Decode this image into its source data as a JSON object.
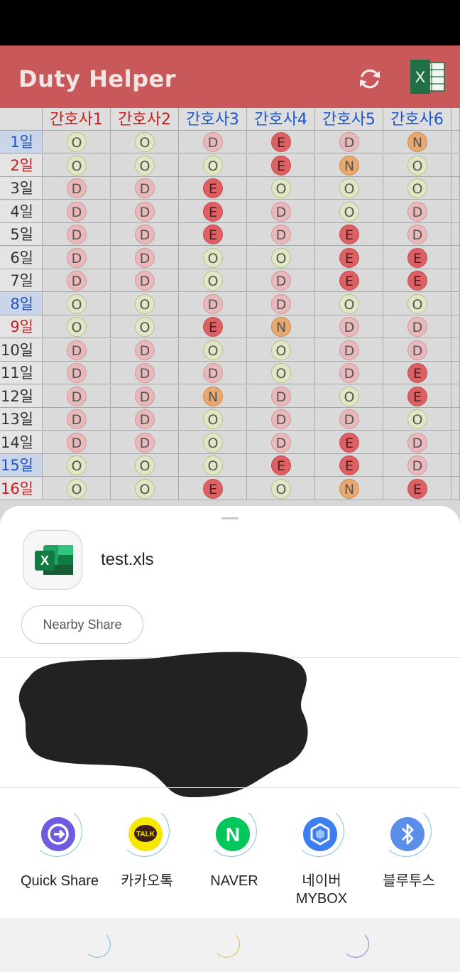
{
  "app": {
    "title": "Duty Helper",
    "icons": {
      "refresh": "refresh-icon",
      "excel": "excel-export-icon"
    }
  },
  "colors": {
    "appbar": "#c8585a",
    "header_red": "#cf1b1b",
    "header_blue": "#1d55c8",
    "off": "#dfe7c4",
    "day": "#e8b8bb",
    "evening": "#df6063",
    "night": "#e8a86e"
  },
  "table": {
    "headers": [
      {
        "label": "간호사1",
        "color": "red"
      },
      {
        "label": "간호사2",
        "color": "red"
      },
      {
        "label": "간호사3",
        "color": "blue"
      },
      {
        "label": "간호사4",
        "color": "blue"
      },
      {
        "label": "간호사5",
        "color": "blue"
      },
      {
        "label": "간호사6",
        "color": "blue"
      }
    ],
    "rows": [
      {
        "day": "1일",
        "style": "blue",
        "shifts": [
          "O",
          "O",
          "D",
          "E",
          "D",
          "N"
        ]
      },
      {
        "day": "2일",
        "style": "red",
        "shifts": [
          "O",
          "O",
          "O",
          "E",
          "N",
          "O"
        ]
      },
      {
        "day": "3일",
        "style": "normal",
        "shifts": [
          "D",
          "D",
          "E",
          "O",
          "O",
          "O"
        ]
      },
      {
        "day": "4일",
        "style": "normal",
        "shifts": [
          "D",
          "D",
          "E",
          "D",
          "O",
          "D"
        ]
      },
      {
        "day": "5일",
        "style": "normal",
        "shifts": [
          "D",
          "D",
          "E",
          "D",
          "E",
          "D"
        ]
      },
      {
        "day": "6일",
        "style": "normal",
        "shifts": [
          "D",
          "D",
          "O",
          "O",
          "E",
          "E"
        ]
      },
      {
        "day": "7일",
        "style": "normal",
        "shifts": [
          "D",
          "D",
          "O",
          "D",
          "E",
          "E"
        ]
      },
      {
        "day": "8일",
        "style": "blue",
        "shifts": [
          "O",
          "O",
          "D",
          "D",
          "O",
          "O"
        ]
      },
      {
        "day": "9일",
        "style": "red",
        "shifts": [
          "O",
          "O",
          "E",
          "N",
          "D",
          "D"
        ]
      },
      {
        "day": "10일",
        "style": "normal",
        "shifts": [
          "D",
          "D",
          "O",
          "O",
          "D",
          "D"
        ]
      },
      {
        "day": "11일",
        "style": "normal",
        "shifts": [
          "D",
          "D",
          "D",
          "O",
          "D",
          "E"
        ]
      },
      {
        "day": "12일",
        "style": "normal",
        "shifts": [
          "D",
          "D",
          "N",
          "D",
          "O",
          "E"
        ]
      },
      {
        "day": "13일",
        "style": "normal",
        "shifts": [
          "D",
          "D",
          "O",
          "D",
          "D",
          "O"
        ]
      },
      {
        "day": "14일",
        "style": "normal",
        "shifts": [
          "D",
          "D",
          "O",
          "D",
          "E",
          "D"
        ]
      },
      {
        "day": "15일",
        "style": "blue",
        "shifts": [
          "O",
          "O",
          "O",
          "E",
          "E",
          "D"
        ]
      },
      {
        "day": "16일",
        "style": "red",
        "shifts": [
          "O",
          "O",
          "E",
          "O",
          "N",
          "E"
        ]
      }
    ]
  },
  "share": {
    "file_name": "test.xls",
    "file_icon": "excel-file-icon",
    "nearby_label": "Nearby Share",
    "apps": [
      {
        "label": "Quick Share",
        "icon": "quick-share-icon"
      },
      {
        "label": "카카오톡",
        "icon": "kakaotalk-icon",
        "icon_text": "TALK"
      },
      {
        "label": "NAVER",
        "icon": "naver-icon",
        "icon_text": "N"
      },
      {
        "label": "네이버\nMYBOX",
        "icon": "naver-mybox-icon"
      },
      {
        "label": "블루투스",
        "icon": "bluetooth-icon"
      }
    ]
  },
  "navbar": {
    "icons": [
      "recent-apps-moon-icon",
      "home-moon-icon",
      "back-moon-icon"
    ]
  }
}
